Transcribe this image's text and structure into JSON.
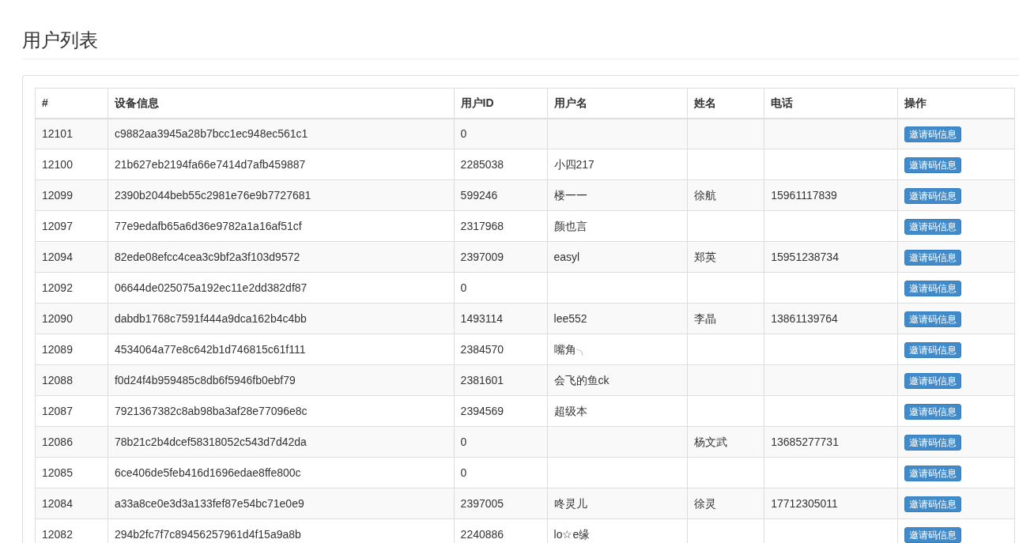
{
  "page_title": "用户列表",
  "table": {
    "columns": [
      "#",
      "设备信息",
      "用户ID",
      "用户名",
      "姓名",
      "电话",
      "操作"
    ],
    "rows": [
      {
        "id": "12101",
        "device": "c9882aa3945a28b7bcc1ec948ec561c1",
        "user_id": "0",
        "username": "",
        "name": "",
        "phone": "",
        "action": "邀请码信息"
      },
      {
        "id": "12100",
        "device": "21b627eb2194fa66e7414d7afb459887",
        "user_id": "2285038",
        "username": "小四217",
        "name": "",
        "phone": "",
        "action": "邀请码信息"
      },
      {
        "id": "12099",
        "device": "2390b2044beb55c2981e76e9b7727681",
        "user_id": "599246",
        "username": "楼一一",
        "name": "徐航",
        "phone": "15961117839",
        "action": "邀请码信息"
      },
      {
        "id": "12097",
        "device": "77e9edafb65a6d36e9782a1a16af51cf",
        "user_id": "2317968",
        "username": "颜也言",
        "name": "",
        "phone": "",
        "action": "邀请码信息"
      },
      {
        "id": "12094",
        "device": "82ede08efcc4cea3c9bf2a3f103d9572",
        "user_id": "2397009",
        "username": "easyl",
        "name": "郑英",
        "phone": "15951238734",
        "action": "邀请码信息"
      },
      {
        "id": "12092",
        "device": "06644de025075a192ec11e2dd382df87",
        "user_id": "0",
        "username": "",
        "name": "",
        "phone": "",
        "action": "邀请码信息"
      },
      {
        "id": "12090",
        "device": "dabdb1768c7591f444a9dca162b4c4bb",
        "user_id": "1493114",
        "username": "lee552",
        "name": "李晶",
        "phone": "13861139764",
        "action": "邀请码信息"
      },
      {
        "id": "12089",
        "device": "4534064a77e8c642b1d746815c61f111",
        "user_id": "2384570",
        "username": "嘴角╮",
        "name": "",
        "phone": "",
        "action": "邀请码信息"
      },
      {
        "id": "12088",
        "device": "f0d24f4b959485c8db6f5946fb0ebf79",
        "user_id": "2381601",
        "username": "会飞的鱼ck",
        "name": "",
        "phone": "",
        "action": "邀请码信息"
      },
      {
        "id": "12087",
        "device": "7921367382c8ab98ba3af28e77096e8c",
        "user_id": "2394569",
        "username": "超级本",
        "name": "",
        "phone": "",
        "action": "邀请码信息"
      },
      {
        "id": "12086",
        "device": "78b21c2b4dcef58318052c543d7d42da",
        "user_id": "0",
        "username": "",
        "name": "杨文武",
        "phone": "13685277731",
        "action": "邀请码信息"
      },
      {
        "id": "12085",
        "device": "6ce406de5feb416d1696edae8ffe800c",
        "user_id": "0",
        "username": "",
        "name": "",
        "phone": "",
        "action": "邀请码信息"
      },
      {
        "id": "12084",
        "device": "a33a8ce0e3d3a133fef87e54bc71e0e9",
        "user_id": "2397005",
        "username": "咚灵儿",
        "name": "徐灵",
        "phone": "17712305011",
        "action": "邀请码信息"
      },
      {
        "id": "12082",
        "device": "294b2fc7f7c89456257961d4f15a9a8b",
        "user_id": "2240886",
        "username": "lo☆e缘",
        "name": "",
        "phone": "",
        "action": "邀请码信息"
      }
    ]
  }
}
